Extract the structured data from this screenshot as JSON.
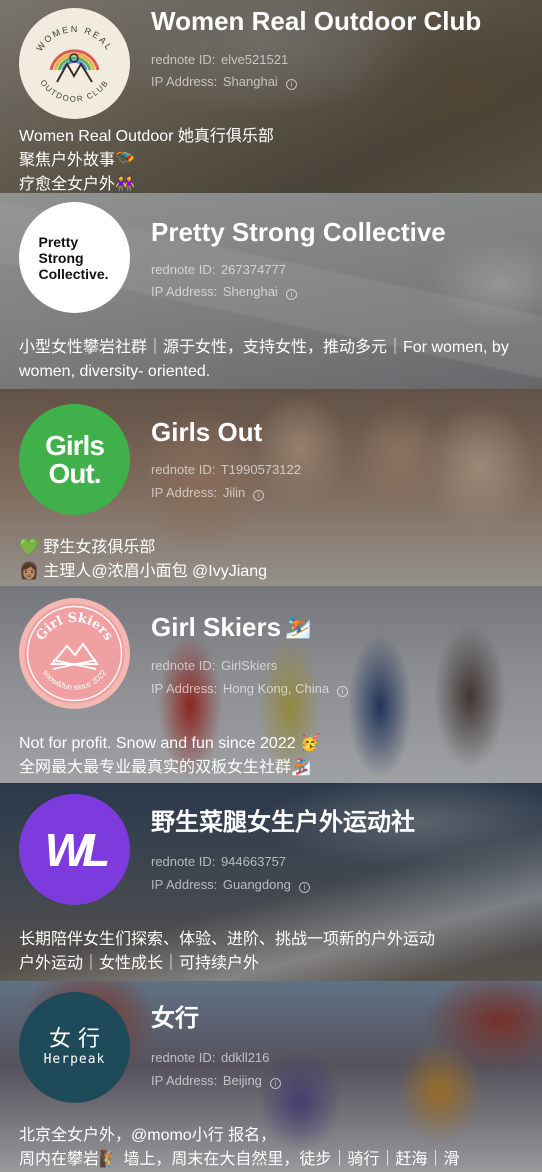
{
  "id_label": "rednote ID:",
  "ip_label": "IP Address:",
  "clubs": [
    {
      "name": "Women Real Outdoor Club",
      "name_emoji": "",
      "id": "elve521521",
      "ip": "Shanghai",
      "bio": "Women Real Outdoor 她真行俱乐部\n聚焦户外故事🪂\n疗愈全女户外👭",
      "avatar_text_top": "WOMEN REAL",
      "avatar_text_bottom": "OUTDOOR CLUB"
    },
    {
      "name": "Pretty Strong Collective",
      "name_emoji": "",
      "id": "267374777",
      "ip": "Shenghai",
      "bio": "小型女性攀岩社群｜源于女性，支持女性，推动多元｜For women, by women, diversity- oriented.",
      "avatar_lines": [
        "Pretty",
        "Strong",
        "Collective."
      ]
    },
    {
      "name": "Girls Out",
      "name_emoji": "",
      "id": "T1990573122",
      "ip": "Jilin",
      "bio": "💚 野生女孩俱乐部\n👩🏽 主理人@浓眉小面包 @IvyJiang",
      "avatar_lines": [
        "Girls",
        "Out."
      ]
    },
    {
      "name": "Girl Skiers",
      "name_emoji": "⛷️",
      "id": "GirlSkiers",
      "ip": "Hong Kong, China",
      "bio": "Not for profit. Snow and fun since 2022 🥳\n全网最大最专业最真实的双板女生社群🏂",
      "avatar_text_top": "Girl Skiers",
      "avatar_text_bottom": "snow&fun since 2022"
    },
    {
      "name": "野生菜腿女生户外运动社",
      "name_emoji": "",
      "id": "944663757",
      "ip": "Guangdong",
      "bio": "长期陪伴女生们探索、体验、进阶、挑战一项新的户外运动\n户外运动｜女性成长｜可持续户外",
      "avatar_lines": [
        "WL"
      ]
    },
    {
      "name": "女行",
      "name_emoji": "",
      "id": "ddkll216",
      "ip": "Beijing",
      "bio": "北京全女户外，@momo小行 报名，\n周内在攀岩🧗 墙上，周末在大自然里，徒步｜骑行｜赶海｜滑",
      "avatar_lines": [
        "女 行",
        "Herpeak"
      ]
    }
  ],
  "colors": {
    "card1_bg": "#8d8371",
    "card2_bg": "#c9cbcc",
    "card3_bg": "#b59a86",
    "card4_bg": "#c9cbd1",
    "card5_bg": "#56616e",
    "card6_bg": "#7b7684",
    "girls_out_green": "#3fb04a",
    "wl_purple": "#7d3bdd",
    "girl_skiers_pink": "#f0a0a0",
    "herpeak_teal": "#1f4a5a"
  }
}
